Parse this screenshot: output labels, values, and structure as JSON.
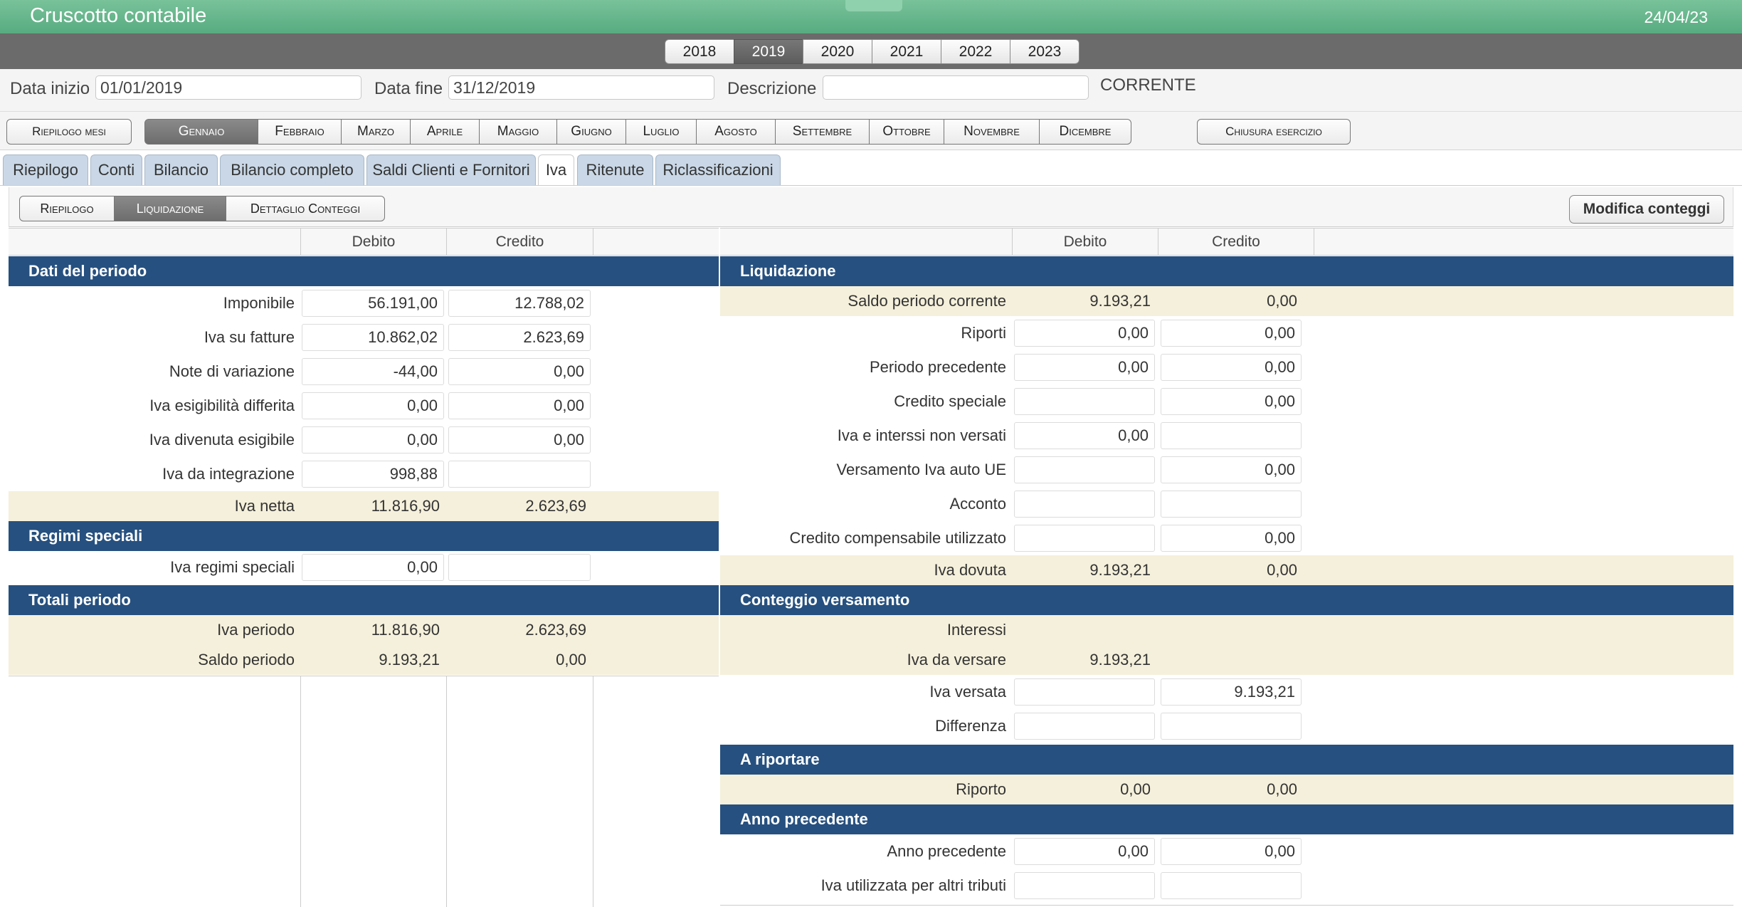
{
  "app": {
    "title": "Cruscotto contabile",
    "date": "24/04/23"
  },
  "years": [
    "2018",
    "2019",
    "2020",
    "2021",
    "2022",
    "2023"
  ],
  "selected_year": "2019",
  "filter": {
    "start_label": "Data inizio",
    "start_value": "01/01/2019",
    "end_label": "Data fine",
    "end_value": "31/12/2019",
    "desc_label": "Descrizione",
    "desc_value": "",
    "status": "CORRENTE"
  },
  "month_bar": {
    "summary": "Riepilogo mesi",
    "months": [
      "Gennaio",
      "Febbraio",
      "Marzo",
      "Aprile",
      "Maggio",
      "Giugno",
      "Luglio",
      "Agosto",
      "Settembre",
      "Ottobre",
      "Novembre",
      "Dicembre"
    ],
    "selected_month": "Gennaio",
    "close": "Chiusura esercizio"
  },
  "tabs": [
    "Riepilogo",
    "Conti",
    "Bilancio",
    "Bilancio completo",
    "Saldi Clienti e Fornitori",
    "Iva",
    "Ritenute",
    "Riclassificazioni"
  ],
  "selected_tab": "Iva",
  "subtabs": [
    "Riepilogo",
    "Liquidazione",
    "Dettaglio Conteggi"
  ],
  "selected_subtab": "Liquidazione",
  "modify_button": "Modifica conteggi",
  "col_debito": "Debito",
  "col_credito": "Credito",
  "left": {
    "section1": "Dati del periodo",
    "rows1": [
      {
        "label": "Imponibile",
        "debito": "56.191,00",
        "credito": "12.788,02"
      },
      {
        "label": "Iva su fatture",
        "debito": "10.862,02",
        "credito": "2.623,69"
      },
      {
        "label": "Note di variazione",
        "debito": "-44,00",
        "credito": "0,00"
      },
      {
        "label": "Iva esigibilità differita",
        "debito": "0,00",
        "credito": "0,00"
      },
      {
        "label": "Iva divenuta esigibile",
        "debito": "0,00",
        "credito": "0,00"
      },
      {
        "label": "Iva da integrazione",
        "debito": "998,88",
        "credito": ""
      }
    ],
    "iva_netta": {
      "label": "Iva netta",
      "debito": "11.816,90",
      "credito": "2.623,69"
    },
    "section2": "Regimi speciali",
    "regimi": {
      "label": "Iva regimi speciali",
      "debito": "0,00",
      "credito": ""
    },
    "section3": "Totali periodo",
    "totali": [
      {
        "label": "Iva periodo",
        "debito": "11.816,90",
        "credito": "2.623,69"
      },
      {
        "label": "Saldo periodo",
        "debito": "9.193,21",
        "credito": "0,00"
      }
    ]
  },
  "right": {
    "section1": "Liquidazione",
    "saldo": {
      "label": "Saldo periodo corrente",
      "debito": "9.193,21",
      "credito": "0,00"
    },
    "rows1": [
      {
        "label": "Riporti",
        "debito": "0,00",
        "credito": "0,00"
      },
      {
        "label": "Periodo precedente",
        "debito": "0,00",
        "credito": "0,00"
      },
      {
        "label": "Credito speciale",
        "debito": "",
        "credito": "0,00"
      },
      {
        "label": "Iva e interssi non versati",
        "debito": "0,00",
        "credito": ""
      },
      {
        "label": "Versamento Iva auto UE",
        "debito": "",
        "credito": "0,00"
      },
      {
        "label": "Acconto",
        "debito": "",
        "credito": ""
      },
      {
        "label": "Credito compensabile utilizzato",
        "debito": "",
        "credito": "0,00"
      }
    ],
    "dovuta": {
      "label": "Iva dovuta",
      "debito": "9.193,21",
      "credito": "0,00"
    },
    "section2": "Conteggio versamento",
    "conteggio_tot": [
      {
        "label": "Interessi",
        "debito": "",
        "credito": ""
      },
      {
        "label": "Iva da versare",
        "debito": "9.193,21",
        "credito": ""
      }
    ],
    "conteggio_rows": [
      {
        "label": "Iva versata",
        "debito": "",
        "credito": "9.193,21"
      },
      {
        "label": "Differenza",
        "debito": "",
        "credito": ""
      }
    ],
    "section3": "A riportare",
    "riporto": {
      "label": "Riporto",
      "debito": "0,00",
      "credito": "0,00"
    },
    "section4": "Anno precedente",
    "anno_rows": [
      {
        "label": "Anno precedente",
        "debito": "0,00",
        "credito": "0,00"
      },
      {
        "label": "Iva utilizzata per altri tributi",
        "debito": "",
        "credito": ""
      }
    ]
  }
}
